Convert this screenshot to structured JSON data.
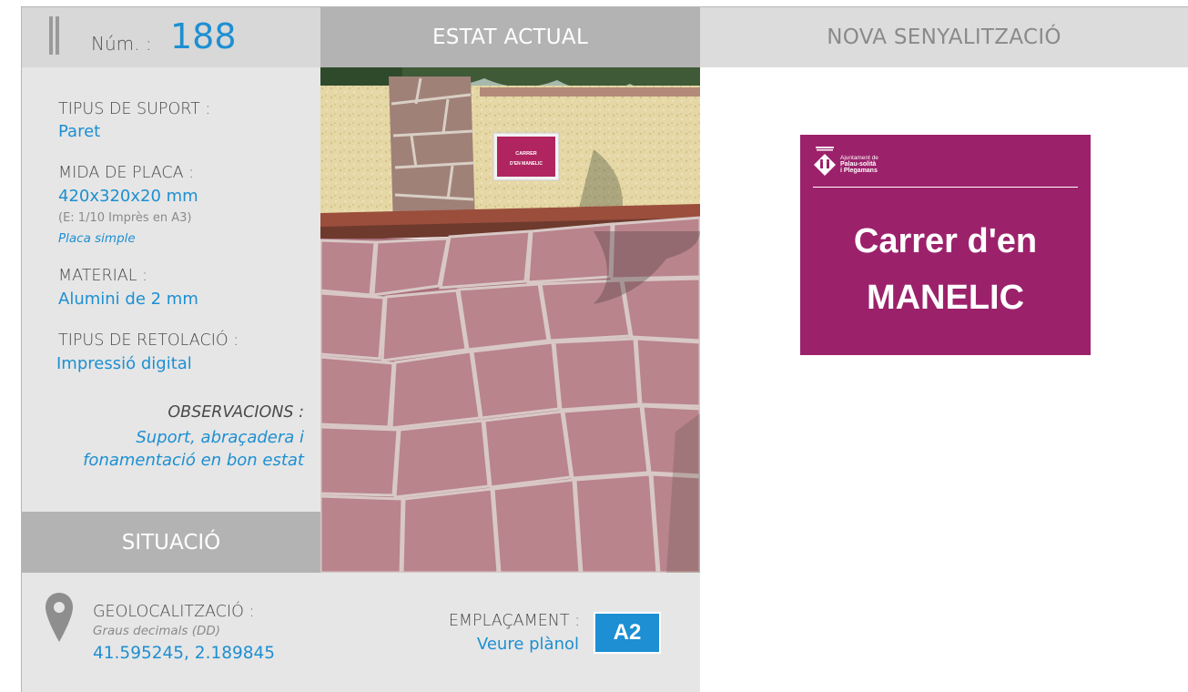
{
  "header": {
    "num_label": "Núm. :",
    "num_value": "188",
    "current_state_title": "ESTAT ACTUAL",
    "new_signage_title": "NOVA SENYALITZACIÓ"
  },
  "info": {
    "support_type_label": "TIPUS DE SUPORT :",
    "support_type_value": "Paret",
    "plate_size_label": "MIDA DE PLACA :",
    "plate_size_value": "420x320x20 mm",
    "plate_scale_note": "(E: 1/10 Imprès en A3)",
    "plate_kind": "Placa simple",
    "material_label": "MATERIAL :",
    "material_value": "Alumini de 2 mm",
    "lettering_label": "TIPUS DE RETOLACIÓ :",
    "lettering_value": "Impressió digital",
    "observations_label": "OBSERVACIONS :",
    "observations_line1": "Suport, abraçadera i",
    "observations_line2": "fonamentació en bon estat"
  },
  "situation": {
    "title": "SITUACIÓ",
    "geo_label": "GEOLOCALITZACIÓ :",
    "geo_format": "Graus decimals (DD)",
    "geo_value": "41.595245, 2.189845",
    "placement_label": "EMPLAÇAMENT :",
    "placement_link": "Veure plànol",
    "placement_code": "A2"
  },
  "photo": {
    "sign_line1": "CARRER",
    "sign_line2": "D'EN MANELIC"
  },
  "new_sign": {
    "org_line1": "Ajuntament de",
    "org_line2": "Palau-solità",
    "org_line3": "i Plegamans",
    "street_line1": "Carrer d'en",
    "street_line2": "MANELIC",
    "color": "#9c216b"
  },
  "colors": {
    "accent_blue": "#1d8fd2",
    "header_gray": "#b3b3b3",
    "panel_gray": "#e6e6e6"
  }
}
